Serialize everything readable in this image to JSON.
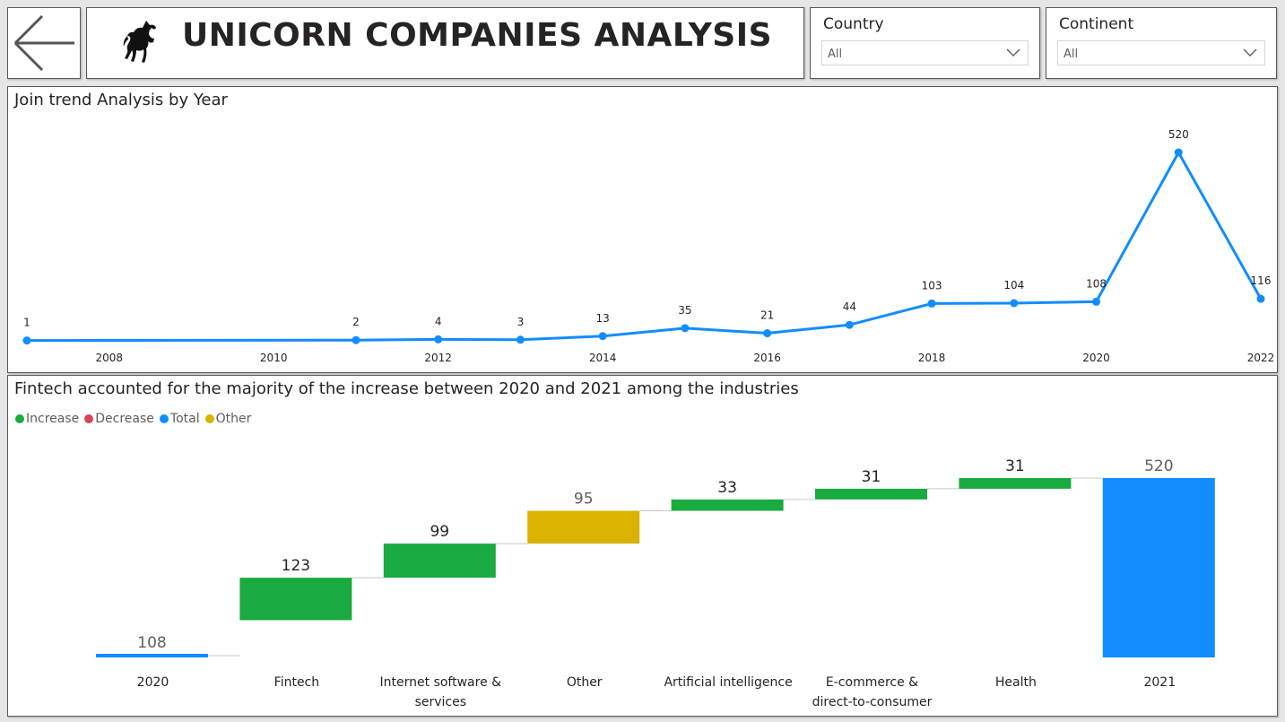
{
  "header": {
    "title": "UNICORN COMPANIES ANALYSIS"
  },
  "filters": {
    "country": {
      "label": "Country",
      "value": "All"
    },
    "continent": {
      "label": "Continent",
      "value": "All"
    }
  },
  "icons": {
    "back": "back-arrow-icon",
    "logo": "unicorn-icon",
    "dropdown": "chevron-down-icon"
  },
  "colors": {
    "line": "#118dff",
    "increase": "#1aab40",
    "decrease": "#d64554",
    "total": "#118dff",
    "other": "#d9b300"
  },
  "chart_data": [
    {
      "type": "line",
      "title": "Join trend Analysis by Year",
      "x": [
        2007,
        2011,
        2012,
        2013,
        2014,
        2015,
        2016,
        2017,
        2018,
        2019,
        2020,
        2021,
        2022
      ],
      "values": [
        1,
        2,
        4,
        3,
        13,
        35,
        21,
        44,
        103,
        104,
        108,
        520,
        116
      ],
      "x_ticks": [
        "2008",
        "2010",
        "2012",
        "2014",
        "2016",
        "2018",
        "2020",
        "2022"
      ],
      "xlim": [
        2007,
        2022
      ],
      "ylim": [
        0,
        520
      ],
      "grid": false
    },
    {
      "type": "bar",
      "subtype": "waterfall",
      "title": "Fintech accounted for the majority of the increase between 2020 and 2021 among the industries",
      "legend": [
        "Increase",
        "Decrease",
        "Total",
        "Other"
      ],
      "legend_position": "top-left",
      "categories": [
        "2020",
        "Fintech",
        "Internet software & services",
        "Other",
        "Artificial intelligence",
        "E-commerce & direct-to-consumer",
        "Health",
        "2021"
      ],
      "category_lines": [
        [
          "2020"
        ],
        [
          "Fintech"
        ],
        [
          "Internet software &",
          "services"
        ],
        [
          "Other"
        ],
        [
          "Artificial intelligence"
        ],
        [
          "E-commerce &",
          "direct-to-consumer"
        ],
        [
          "Health"
        ],
        [
          "2021"
        ]
      ],
      "values": [
        108,
        123,
        99,
        95,
        33,
        31,
        31,
        520
      ],
      "kinds": [
        "total",
        "increase",
        "increase",
        "other",
        "increase",
        "increase",
        "increase",
        "total"
      ]
    }
  ]
}
